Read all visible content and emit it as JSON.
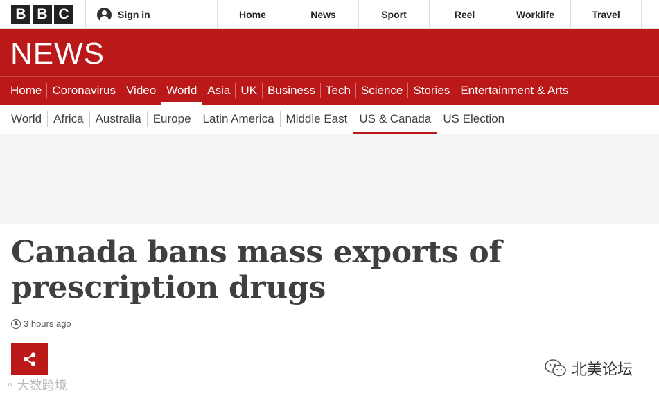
{
  "header": {
    "logo_letters": [
      "B",
      "B",
      "C"
    ],
    "signin_label": "Sign in",
    "nav": [
      "Home",
      "News",
      "Sport",
      "Reel",
      "Worklife",
      "Travel"
    ]
  },
  "banner": {
    "title": "NEWS"
  },
  "primary_nav": {
    "items": [
      "Home",
      "Coronavirus",
      "Video",
      "World",
      "Asia",
      "UK",
      "Business",
      "Tech",
      "Science",
      "Stories",
      "Entertainment & Arts"
    ],
    "active": "World"
  },
  "secondary_nav": {
    "items": [
      "World",
      "Africa",
      "Australia",
      "Europe",
      "Latin America",
      "Middle East",
      "US & Canada",
      "US Election"
    ],
    "active": "US & Canada"
  },
  "article": {
    "headline": "Canada bans mass exports of prescription drugs",
    "timestamp": "3 hours ago"
  },
  "watermarks": {
    "left_text": "大数跨境",
    "right_text": "北美论坛"
  },
  "colors": {
    "brand_red": "#bb1919",
    "headline": "#3f3f42"
  }
}
